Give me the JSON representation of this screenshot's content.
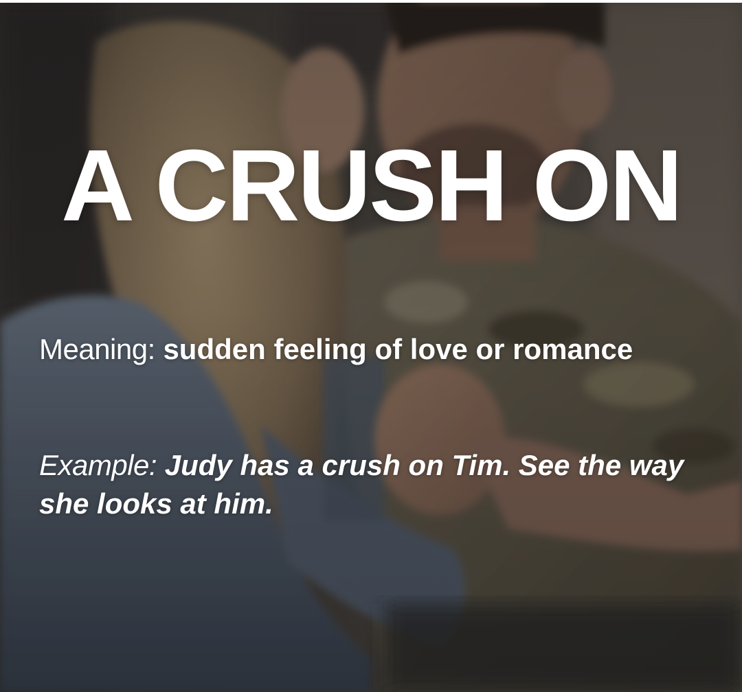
{
  "title": "A CRUSH ON",
  "meaning": {
    "label": "Meaning:",
    "text": "sudden feeling of love or romance"
  },
  "example": {
    "label": "Example:",
    "text": "Judy has a crush on Tim. See the way she looks at him."
  },
  "colors": {
    "text": "#ffffff",
    "overlay": "#1e1b19"
  }
}
